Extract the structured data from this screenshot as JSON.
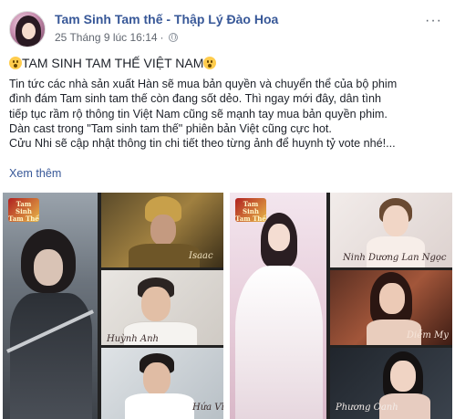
{
  "post": {
    "page_name": "Tam Sinh Tam thế - Thập Lý Đào Hoa",
    "timestamp": "25 Tháng 9 lúc 16:14",
    "separator": "·",
    "more_label": "···",
    "headline": "TAM SINH TAM THẾ VIỆT NAM",
    "body_lines": [
      "Tin tức các nhà sản xuất Hàn sẽ mua bản quyền và chuyển thể của bộ phim",
      "đình đám Tam sinh tam thế còn đang sốt dẻo. Thì ngay mới đây, dân tình",
      "tiếp tục rầm rộ thông tin Việt Nam cũng sẽ mạnh tay mua bản quyền phim.",
      "Dàn cast trong \"Tam sinh tam thế\" phiên bản Việt cũng cực hot.",
      "Cửu Nhi sẽ cập nhật thông tin chi tiết theo từng ảnh để huynh tỷ vote nhé!..."
    ],
    "see_more": "Xem thêm"
  },
  "photos": {
    "left": {
      "logo": "Tam Sinh Tam Thế",
      "captions": [
        "Isaac",
        "Huỳnh Anh",
        "Hứa Vĩ"
      ]
    },
    "right": {
      "logo": "Tam Sinh Tam Thế",
      "captions": [
        "Ninh Dương Lan Ngọc",
        "Diễm My",
        "Phương Oanh"
      ]
    }
  },
  "colors": {
    "link": "#385898",
    "text": "#1d2129",
    "meta": "#616770"
  }
}
